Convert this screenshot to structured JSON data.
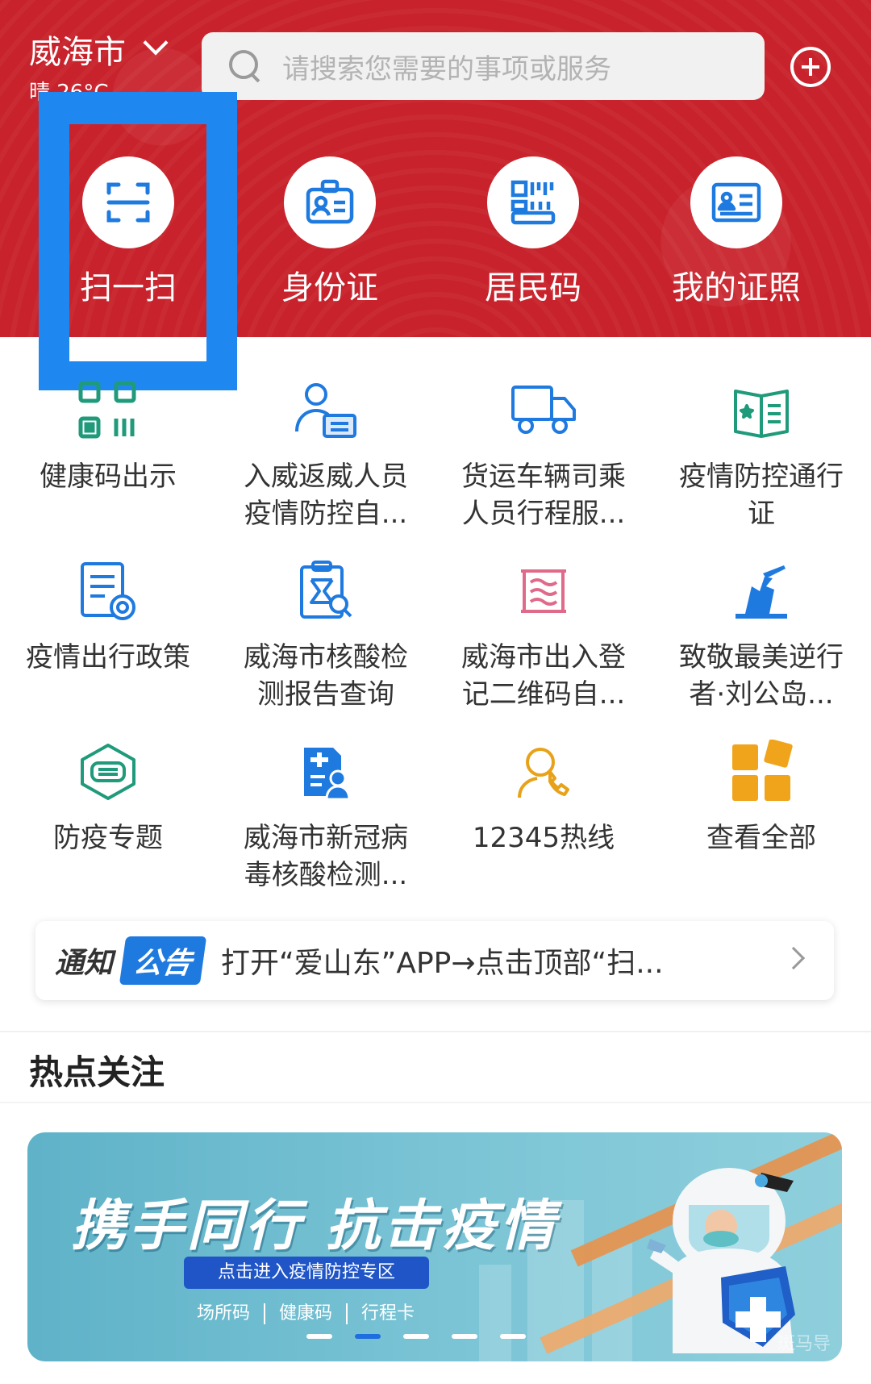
{
  "header": {
    "city": "威海市",
    "weather": "晴 26°C",
    "search_placeholder": "请搜索您需要的事项或服务",
    "colors": {
      "header_bg": "#c8232c",
      "icon_blue": "#1f7ae0",
      "highlight": "#1f88f0"
    }
  },
  "quick_actions": [
    {
      "label": "扫一扫",
      "icon": "scan-icon"
    },
    {
      "label": "身份证",
      "icon": "id-card-icon"
    },
    {
      "label": "居民码",
      "icon": "resident-code-icon"
    },
    {
      "label": "我的证照",
      "icon": "license-icon"
    }
  ],
  "services": [
    {
      "line1": "健康码出示",
      "line2": "",
      "icon": "health-code-icon"
    },
    {
      "line1": "入威返威人员",
      "line2": "疫情防控自...",
      "icon": "person-card-icon"
    },
    {
      "line1": "货运车辆司乘",
      "line2": "人员行程服...",
      "icon": "truck-icon"
    },
    {
      "line1": "疫情防控通行",
      "line2": "证",
      "icon": "pass-book-icon"
    },
    {
      "line1": "疫情出行政策",
      "line2": "",
      "icon": "policy-doc-icon"
    },
    {
      "line1": "威海市核酸检",
      "line2": "测报告查询",
      "icon": "report-search-icon"
    },
    {
      "line1": "威海市出入登",
      "line2": "记二维码自...",
      "icon": "register-icon"
    },
    {
      "line1": "致敬最美逆行",
      "line2": "者·刘公岛...",
      "icon": "monument-icon"
    },
    {
      "line1": "防疫专题",
      "line2": "",
      "icon": "mask-icon"
    },
    {
      "line1": "威海市新冠病",
      "line2": "毒核酸检测...",
      "icon": "doctor-doc-icon"
    },
    {
      "line1": "12345热线",
      "line2": "",
      "icon": "hotline-icon"
    },
    {
      "line1": "查看全部",
      "line2": "",
      "icon": "all-apps-icon"
    }
  ],
  "notice": {
    "tag1": "通知",
    "tag2": "公告",
    "text": "打开“爱山东”APP→点击顶部“扫..."
  },
  "hot": {
    "title": "热点关注",
    "banner": {
      "slogan": "携手同行 抗击疫情",
      "button": "点击进入疫情防控专区",
      "links": [
        "场所码",
        "健康码",
        "行程卡"
      ],
      "watermark": "斑马导",
      "active_dot": 1,
      "dot_count": 5
    }
  }
}
